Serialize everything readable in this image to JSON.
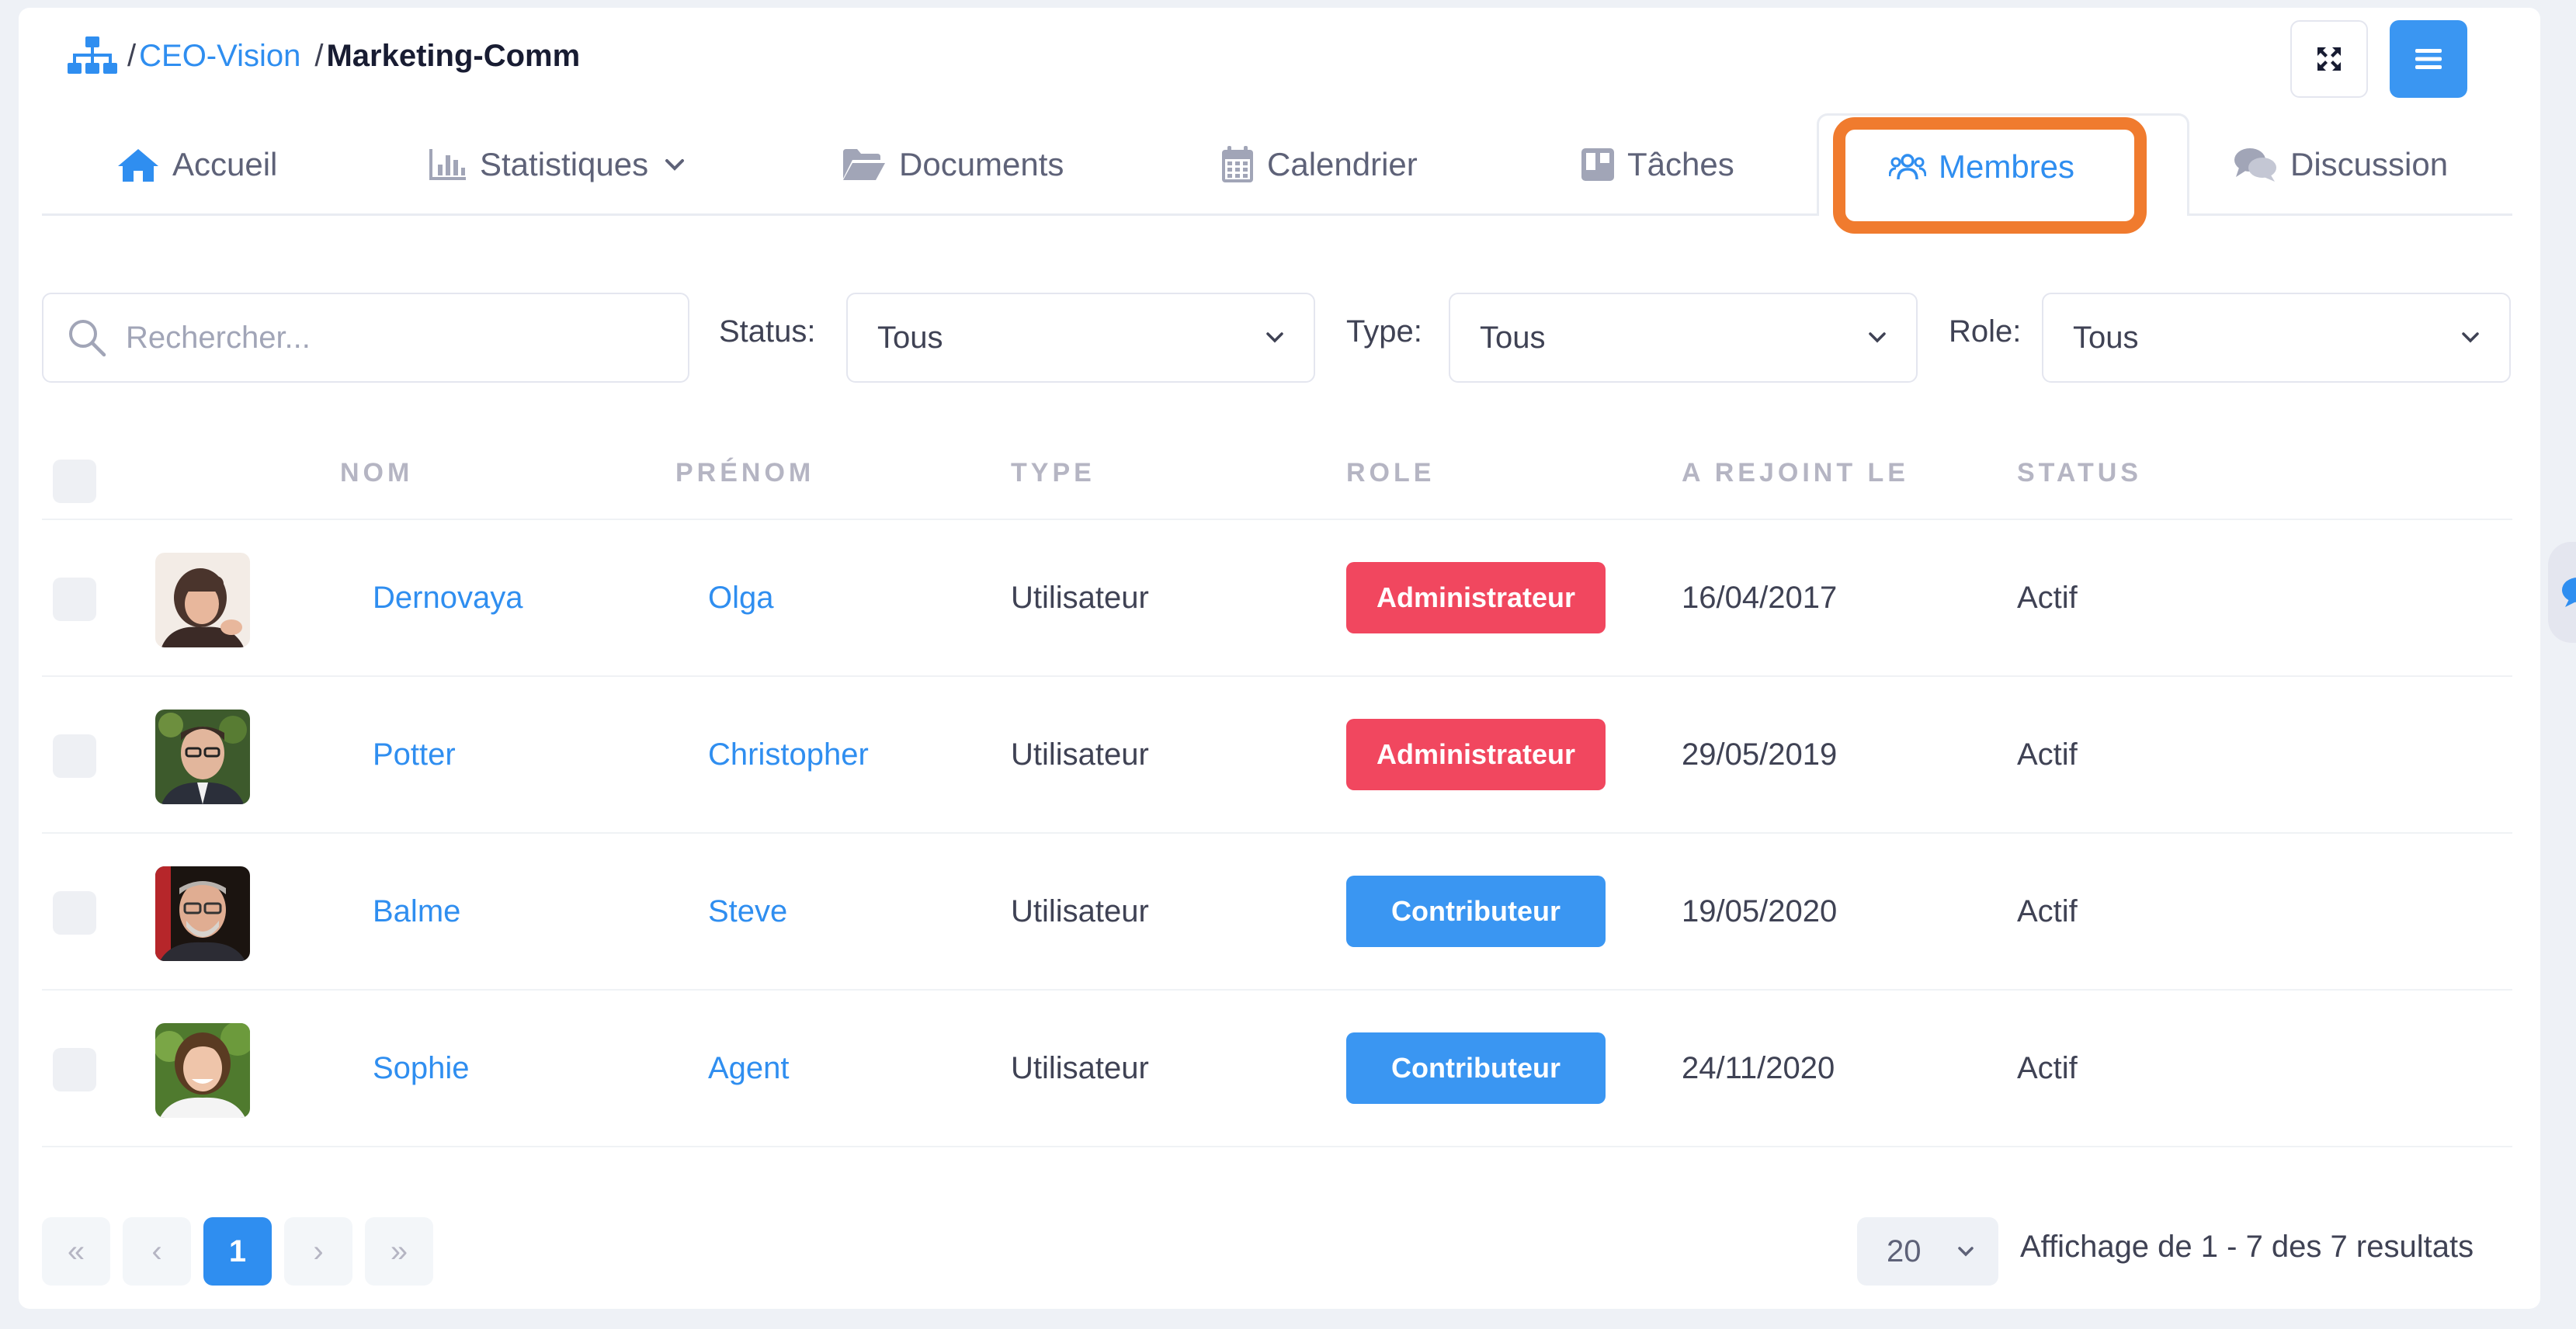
{
  "breadcrumb": {
    "sep1": "/",
    "parent": "CEO-Vision",
    "sep2": "/",
    "current": "Marketing-Comm"
  },
  "tabs": [
    {
      "label": "Accueil",
      "icon": "home-icon"
    },
    {
      "label": "Statistiques",
      "icon": "bar-chart-icon"
    },
    {
      "label": "Documents",
      "icon": "folder-open-icon"
    },
    {
      "label": "Calendrier",
      "icon": "calendar-icon"
    },
    {
      "label": "Tâches",
      "icon": "kanban-icon"
    },
    {
      "label": "Membres",
      "icon": "users-icon",
      "active": true
    },
    {
      "label": "Discussion",
      "icon": "comments-icon"
    }
  ],
  "filters": {
    "search_placeholder": "Rechercher...",
    "status_label": "Status:",
    "status_value": "Tous",
    "type_label": "Type:",
    "type_value": "Tous",
    "role_label": "Role:",
    "role_value": "Tous"
  },
  "table": {
    "headers": [
      "NOM",
      "PRÉNOM",
      "TYPE",
      "ROLE",
      "A REJOINT LE",
      "STATUS"
    ],
    "rows": [
      {
        "nom": "Dernovaya",
        "prenom": "Olga",
        "type": "Utilisateur",
        "role": "Administrateur",
        "joined": "16/04/2017",
        "status": "Actif"
      },
      {
        "nom": "Potter",
        "prenom": "Christopher",
        "type": "Utilisateur",
        "role": "Administrateur",
        "joined": "29/05/2019",
        "status": "Actif"
      },
      {
        "nom": "Balme",
        "prenom": "Steve",
        "type": "Utilisateur",
        "role": "Contributeur",
        "joined": "19/05/2020",
        "status": "Actif"
      },
      {
        "nom": "Sophie",
        "prenom": "Agent",
        "type": "Utilisateur",
        "role": "Contributeur",
        "joined": "24/11/2020",
        "status": "Actif"
      }
    ]
  },
  "pagination": {
    "first": "«",
    "prev": "‹",
    "current_page": "1",
    "next": "›",
    "last": "»",
    "per_page": "20",
    "summary": "Affichage de 1 - 7 des 7 resultats"
  },
  "colors": {
    "accent": "#2f8ef0",
    "admin_badge": "#f1475f",
    "contrib_badge": "#3a96f2",
    "highlight": "#f07b2e"
  }
}
